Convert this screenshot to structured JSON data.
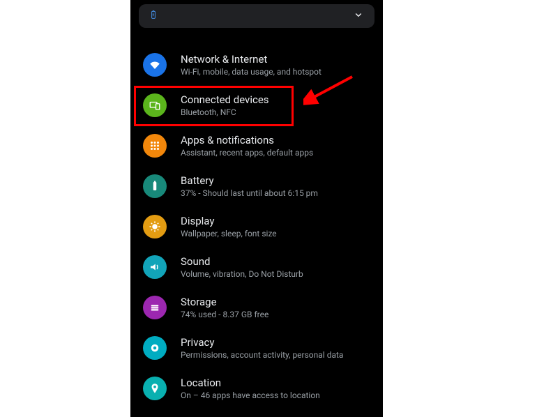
{
  "notification": {
    "icon": "battery-icon",
    "expand_icon": "chevron-down-icon"
  },
  "settings": {
    "items": [
      {
        "title": "Network & Internet",
        "subtitle": "Wi-Fi, mobile, data usage, and hotspot",
        "icon": "wifi-icon",
        "color": "#1a73e8"
      },
      {
        "title": "Connected devices",
        "subtitle": "Bluetooth, NFC",
        "icon": "devices-icon",
        "color": "#5bb51c",
        "highlighted": true
      },
      {
        "title": "Apps & notifications",
        "subtitle": "Assistant, recent apps, default apps",
        "icon": "apps-icon",
        "color": "#f2870b"
      },
      {
        "title": "Battery",
        "subtitle": "37% - Should last until about 6:15 pm",
        "icon": "battery-icon",
        "color": "#18897a"
      },
      {
        "title": "Display",
        "subtitle": "Wallpaper, sleep, font size",
        "icon": "display-icon",
        "color": "#e39c12"
      },
      {
        "title": "Sound",
        "subtitle": "Volume, vibration, Do Not Disturb",
        "icon": "sound-icon",
        "color": "#12a4b9"
      },
      {
        "title": "Storage",
        "subtitle": "74% used - 8.37 GB free",
        "icon": "storage-icon",
        "color": "#9c27b0"
      },
      {
        "title": "Privacy",
        "subtitle": "Permissions, account activity, personal data",
        "icon": "privacy-icon",
        "color": "#00acc1"
      },
      {
        "title": "Location",
        "subtitle": "On – 46 apps have access to location",
        "icon": "location-icon",
        "color": "#09b0b0"
      }
    ]
  }
}
